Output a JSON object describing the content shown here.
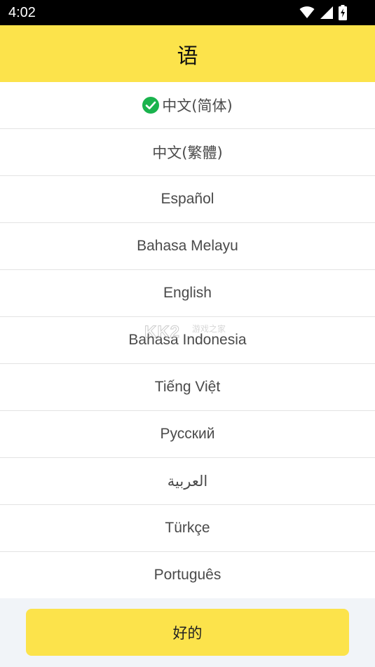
{
  "status_bar": {
    "time": "4:02",
    "icons": [
      "wifi-icon",
      "cellular-signal-icon",
      "battery-charging-icon"
    ]
  },
  "header": {
    "title": "语"
  },
  "languages": [
    {
      "label": "中文(简体)",
      "selected": true
    },
    {
      "label": "中文(繁體)",
      "selected": false
    },
    {
      "label": "Español",
      "selected": false
    },
    {
      "label": "Bahasa Melayu",
      "selected": false
    },
    {
      "label": "English",
      "selected": false
    },
    {
      "label": "Bahasa Indonesia",
      "selected": false
    },
    {
      "label": "Tiếng Việt",
      "selected": false
    },
    {
      "label": "Русский",
      "selected": false
    },
    {
      "label": "العربية",
      "selected": false
    },
    {
      "label": "Türkçe",
      "selected": false
    },
    {
      "label": "Português",
      "selected": false
    }
  ],
  "watermark": {
    "logo": "KK2",
    "text": "游戏之家"
  },
  "footer": {
    "ok_label": "好的"
  },
  "colors": {
    "header_bg": "#fce34b",
    "button_bg": "#fce34b",
    "check_green": "#1ab34d",
    "footer_bg": "#f1f4f8"
  }
}
